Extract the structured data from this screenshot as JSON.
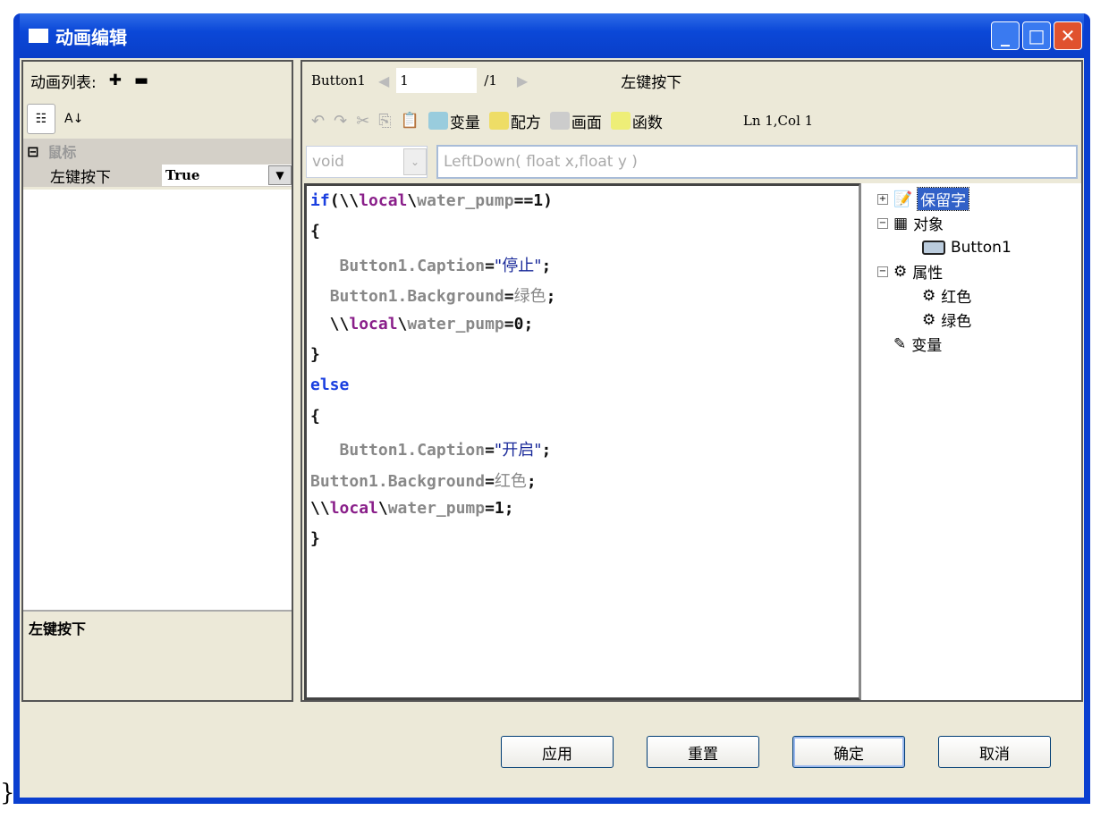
{
  "window": {
    "title": "动画编辑"
  },
  "left": {
    "list_label": "动画列表:",
    "group": "鼠标",
    "property": {
      "name": "左键按下",
      "value": "True"
    },
    "description": "左键按下"
  },
  "editor": {
    "object": "Button1",
    "page": "1",
    "total": "/1",
    "event": "左键按下",
    "toolbar": {
      "variable": "变量",
      "recipe": "配方",
      "screen": "画面",
      "function": "函数",
      "position": "Ln 1,Col 1"
    },
    "return_type": "void",
    "signature": "LeftDown( float x,float y )"
  },
  "code": [
    [
      [
        "kw",
        "if"
      ],
      [
        "bk",
        "(\\\\"
      ],
      [
        "pp",
        "local"
      ],
      [
        "bk",
        "\\"
      ],
      [
        "gy",
        "water_pump"
      ],
      [
        "bk",
        "==1)"
      ]
    ],
    [
      [
        "bk",
        "{"
      ]
    ],
    [
      [
        "bk",
        "   "
      ],
      [
        "gy",
        "Button1.Caption"
      ],
      [
        "bk",
        "="
      ],
      [
        "st",
        "\"停止\""
      ],
      [
        "bk",
        ";"
      ]
    ],
    [
      [
        "bk",
        "  "
      ],
      [
        "gy",
        "Button1.Background"
      ],
      [
        "bk",
        "="
      ],
      [
        "cn",
        "绿色"
      ],
      [
        "bk",
        ";"
      ]
    ],
    [
      [
        "bk",
        "  \\\\"
      ],
      [
        "pp",
        "local"
      ],
      [
        "bk",
        "\\"
      ],
      [
        "gy",
        "water_pump"
      ],
      [
        "bk",
        "=0;"
      ]
    ],
    [
      [
        "bk",
        "}"
      ]
    ],
    [
      [
        "kw",
        "else"
      ]
    ],
    [
      [
        "bk",
        "{"
      ]
    ],
    [
      [
        "bk",
        "   "
      ],
      [
        "gy",
        "Button1.Caption"
      ],
      [
        "bk",
        "="
      ],
      [
        "st",
        "\"开启\""
      ],
      [
        "bk",
        ";"
      ]
    ],
    [
      [
        "gy",
        "Button1.Background"
      ],
      [
        "bk",
        "="
      ],
      [
        "cn",
        "红色"
      ],
      [
        "bk",
        ";"
      ]
    ],
    [
      [
        "bk",
        "\\\\"
      ],
      [
        "pp",
        "local"
      ],
      [
        "bk",
        "\\"
      ],
      [
        "gy",
        "water_pump"
      ],
      [
        "bk",
        "=1;"
      ]
    ],
    [
      [
        "bk",
        "}"
      ]
    ]
  ],
  "tree": {
    "reserved": "保留字",
    "objects": "对象",
    "button": "Button1",
    "properties": "属性",
    "red": "红色",
    "green": "绿色",
    "variables": "变量"
  },
  "buttons": {
    "apply": "应用",
    "reset": "重置",
    "ok": "确定",
    "cancel": "取消"
  },
  "stray": "}"
}
